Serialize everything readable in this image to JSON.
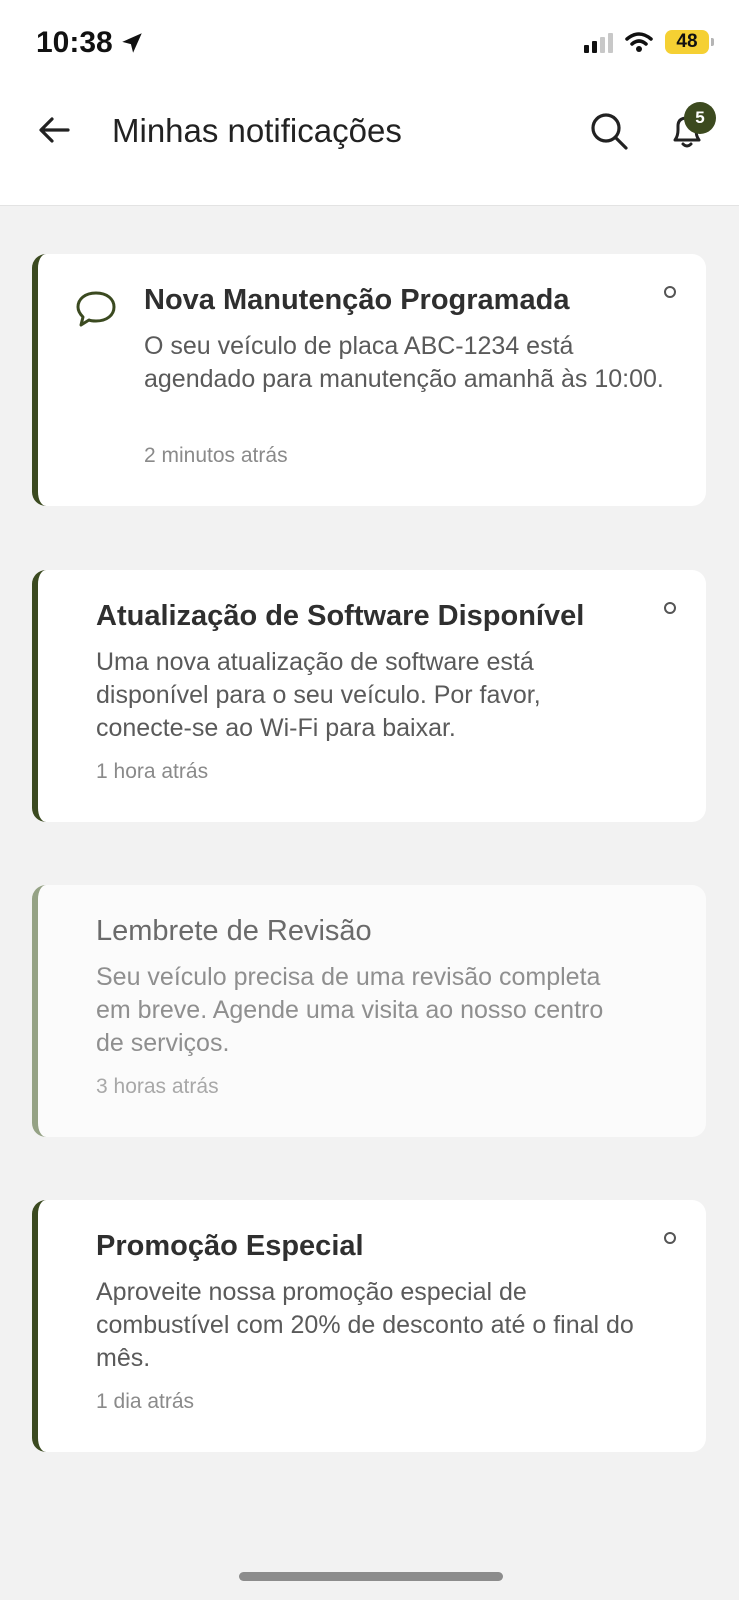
{
  "status_bar": {
    "time": "10:38",
    "battery": "48"
  },
  "header": {
    "title": "Minhas notificações",
    "badge_count": "5"
  },
  "notifications": [
    {
      "title": "Nova Manutenção Programada",
      "body": "O seu veículo de placa ABC-1234 está agendado para manutenção amanhã às 10:00.",
      "time": "2 minutos atrás",
      "icon": "message-icon",
      "read": false
    },
    {
      "title": "Atualização de Software Disponível",
      "body": "Uma nova atualização de software está disponível para o seu veículo. Por favor, conecte-se ao Wi-Fi para baixar.",
      "time": "1 hora atrás",
      "read": false
    },
    {
      "title": "Lembrete de Revisão",
      "body": "Seu veículo precisa de uma revisão completa em breve. Agende uma visita ao nosso centro de serviços.",
      "time": "3 horas atrás",
      "read": true
    },
    {
      "title": "Promoção Especial",
      "body": "Aproveite nossa promoção especial de combustível com 20% de desconto até o final do mês.",
      "time": "1 dia atrás",
      "read": false
    }
  ],
  "colors": {
    "accent": "#3b4a20",
    "accent_read": "#95a285",
    "battery": "#f5d033"
  }
}
